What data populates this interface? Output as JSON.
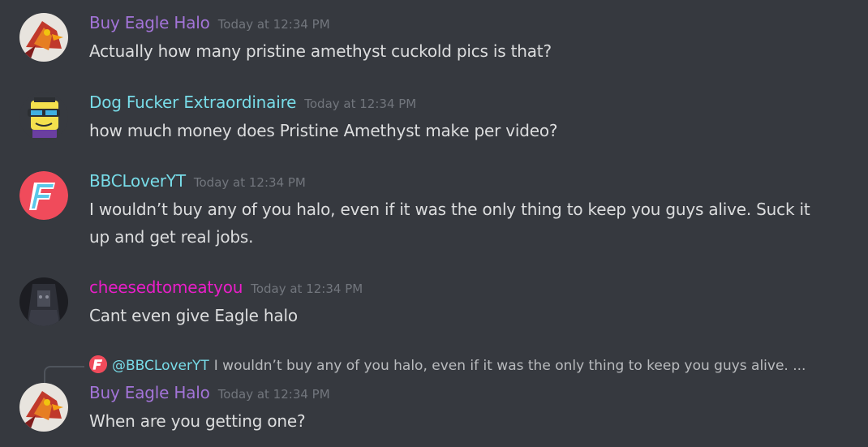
{
  "messages": [
    {
      "username": "Buy Eagle Halo",
      "username_color": "#a374d8",
      "timestamp": "Today at 12:34 PM",
      "text": "Actually how many pristine amethyst cuckold pics is that?",
      "avatar": "eagle-avatar-icon"
    },
    {
      "username": "Dog Fucker Extraordinaire",
      "username_color": "#78dce8",
      "timestamp": "Today at 12:34 PM",
      "text": "how much money does Pristine Amethyst make per video?",
      "avatar": "sponge-avatar-icon"
    },
    {
      "username": "BBCLoverYT",
      "username_color": "#78dce8",
      "timestamp": "Today at 12:34 PM",
      "text": "I wouldn’t buy any of you halo, even if it was the only thing to keep you guys alive. Suck it up and get real jobs.",
      "avatar": "f-logo-avatar-icon"
    },
    {
      "username": "cheesedtomeatyou",
      "username_color": "#e91ec8",
      "timestamp": "Today at 12:34 PM",
      "text": "Cant even give Eagle halo",
      "avatar": "dark-avatar-icon"
    },
    {
      "username": "Buy Eagle Halo",
      "username_color": "#a374d8",
      "timestamp": "Today at 12:34 PM",
      "text": "When are you getting one?",
      "avatar": "eagle-avatar-icon"
    }
  ],
  "reply": {
    "mention": "@BBCLoverYT",
    "preview": "I wouldn’t buy any of you halo, even if it was the only thing to keep you guys alive. ..."
  },
  "colors": {
    "background": "#36393f",
    "text": "#dcddde",
    "timestamp": "#72767d"
  }
}
